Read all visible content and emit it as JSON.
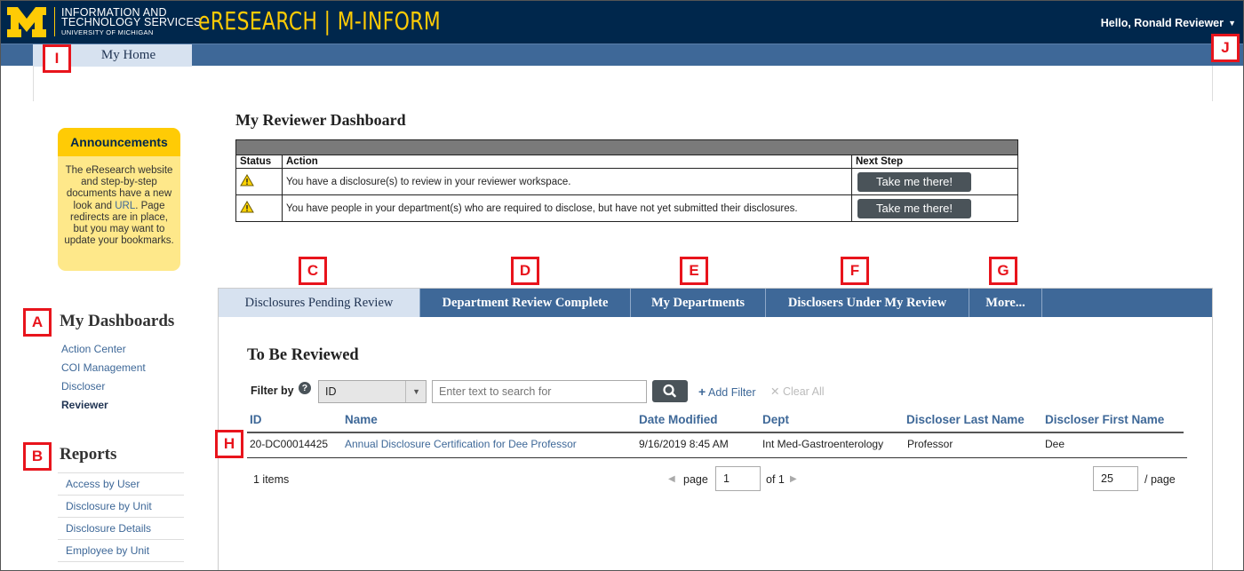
{
  "header": {
    "its_line1": "INFORMATION AND",
    "its_line2": "TECHNOLOGY SERVICES",
    "its_line3": "UNIVERSITY OF MICHIGAN",
    "app_title": "eRESEARCH | M-INFORM",
    "greeting": "Hello, Ronald Reviewer",
    "brand_color": "#00274c",
    "accent_color": "#ffcb05"
  },
  "nav": {
    "home_tab": "My Home"
  },
  "announcements": {
    "title": "Announcements",
    "body_before_link": "The eResearch website and step-by-step documents have a new look and ",
    "link_text": "URL",
    "body_after_link": ". Page redirects are in place, but you may want to update your bookmarks."
  },
  "sidebar": {
    "dashboards_heading": "My Dashboards",
    "dashboards": [
      "Action Center",
      "COI Management",
      "Discloser",
      "Reviewer"
    ],
    "reports_heading": "Reports",
    "reports": [
      "Access by User",
      "Disclosure by Unit",
      "Disclosure Details",
      "Employee by Unit"
    ]
  },
  "reviewer_dashboard": {
    "title": "My Reviewer Dashboard",
    "headers": {
      "status": "Status",
      "action": "Action",
      "next_step": "Next Step"
    },
    "rows": [
      {
        "status_icon": "warning-icon",
        "action": "You have a disclosure(s) to review in your reviewer workspace.",
        "button": "Take me there!"
      },
      {
        "status_icon": "warning-icon",
        "action": "You have people in your department(s) who are required to disclose, but have not yet submitted their disclosures.",
        "button": "Take me there!"
      }
    ]
  },
  "tabs": [
    {
      "label": "Disclosures Pending Review",
      "active": true
    },
    {
      "label": "Department Review Complete",
      "active": false
    },
    {
      "label": "My Departments",
      "active": false
    },
    {
      "label": "Disclosers Under My Review",
      "active": false
    },
    {
      "label": "More...",
      "active": false
    }
  ],
  "to_be_reviewed": {
    "title": "To Be Reviewed",
    "filter_label": "Filter by",
    "filter_value": "ID",
    "search_placeholder": "Enter text to search for",
    "add_filter": "Add Filter",
    "clear_all": "Clear All",
    "columns": [
      "ID",
      "Name",
      "Date Modified",
      "Dept",
      "Discloser Last Name",
      "Discloser First Name"
    ],
    "rows": [
      [
        "20-DC00014425",
        "Annual Disclosure Certification for Dee Professor",
        "9/16/2019 8:45 AM",
        "Int Med-Gastroenterology",
        "Professor",
        "Dee"
      ]
    ],
    "items_count": "1 items",
    "page_label": "page",
    "page_value": "1",
    "page_of": "of 1",
    "per_page_value": "25",
    "per_page_label": "/ page"
  },
  "markers": [
    "A",
    "B",
    "C",
    "D",
    "E",
    "F",
    "G",
    "H",
    "I",
    "J"
  ]
}
